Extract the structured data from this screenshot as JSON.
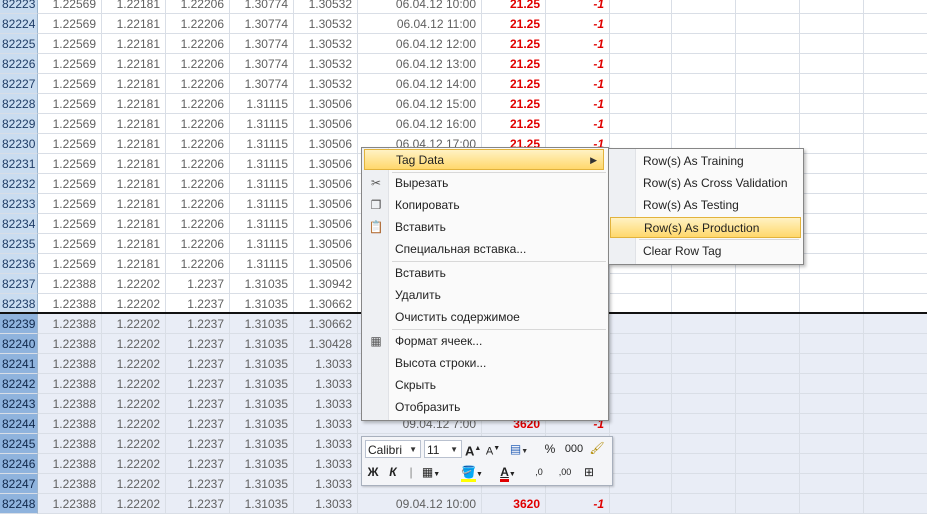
{
  "spreadsheet": {
    "rows": [
      {
        "num": "82223",
        "cells": [
          "1.22569",
          "1.22181",
          "1.22206",
          "1.30774",
          "1.30532",
          "06.04.12 10:00",
          "21.25",
          "-1"
        ],
        "sel": false
      },
      {
        "num": "82224",
        "cells": [
          "1.22569",
          "1.22181",
          "1.22206",
          "1.30774",
          "1.30532",
          "06.04.12 11:00",
          "21.25",
          "-1"
        ],
        "sel": false
      },
      {
        "num": "82225",
        "cells": [
          "1.22569",
          "1.22181",
          "1.22206",
          "1.30774",
          "1.30532",
          "06.04.12 12:00",
          "21.25",
          "-1"
        ],
        "sel": false
      },
      {
        "num": "82226",
        "cells": [
          "1.22569",
          "1.22181",
          "1.22206",
          "1.30774",
          "1.30532",
          "06.04.12 13:00",
          "21.25",
          "-1"
        ],
        "sel": false
      },
      {
        "num": "82227",
        "cells": [
          "1.22569",
          "1.22181",
          "1.22206",
          "1.30774",
          "1.30532",
          "06.04.12 14:00",
          "21.25",
          "-1"
        ],
        "sel": false
      },
      {
        "num": "82228",
        "cells": [
          "1.22569",
          "1.22181",
          "1.22206",
          "1.31115",
          "1.30506",
          "06.04.12 15:00",
          "21.25",
          "-1"
        ],
        "sel": false
      },
      {
        "num": "82229",
        "cells": [
          "1.22569",
          "1.22181",
          "1.22206",
          "1.31115",
          "1.30506",
          "06.04.12 16:00",
          "21.25",
          "-1"
        ],
        "sel": false
      },
      {
        "num": "82230",
        "cells": [
          "1.22569",
          "1.22181",
          "1.22206",
          "1.31115",
          "1.30506",
          "06.04.12 17:00",
          "21.25",
          "-1"
        ],
        "sel": false
      },
      {
        "num": "82231",
        "cells": [
          "1.22569",
          "1.22181",
          "1.22206",
          "1.31115",
          "1.30506",
          "",
          "",
          ""
        ],
        "sel": false
      },
      {
        "num": "82232",
        "cells": [
          "1.22569",
          "1.22181",
          "1.22206",
          "1.31115",
          "1.30506",
          "",
          "",
          ""
        ],
        "sel": false
      },
      {
        "num": "82233",
        "cells": [
          "1.22569",
          "1.22181",
          "1.22206",
          "1.31115",
          "1.30506",
          "",
          "",
          ""
        ],
        "sel": false
      },
      {
        "num": "82234",
        "cells": [
          "1.22569",
          "1.22181",
          "1.22206",
          "1.31115",
          "1.30506",
          "",
          "",
          ""
        ],
        "sel": false
      },
      {
        "num": "82235",
        "cells": [
          "1.22569",
          "1.22181",
          "1.22206",
          "1.31115",
          "1.30506",
          "",
          "",
          ""
        ],
        "sel": false
      },
      {
        "num": "82236",
        "cells": [
          "1.22569",
          "1.22181",
          "1.22206",
          "1.31115",
          "1.30506",
          "",
          "",
          ""
        ],
        "sel": false
      },
      {
        "num": "82237",
        "cells": [
          "1.22388",
          "1.22202",
          "1.2237",
          "1.31035",
          "1.30942",
          "",
          "",
          ""
        ],
        "sel": false
      },
      {
        "num": "82238",
        "cells": [
          "1.22388",
          "1.22202",
          "1.2237",
          "1.31035",
          "1.30662",
          "",
          "",
          ""
        ],
        "sel": false
      },
      {
        "num": "82239",
        "cells": [
          "1.22388",
          "1.22202",
          "1.2237",
          "1.31035",
          "1.30662",
          "",
          "",
          ""
        ],
        "sel": true
      },
      {
        "num": "82240",
        "cells": [
          "1.22388",
          "1.22202",
          "1.2237",
          "1.31035",
          "1.30428",
          "",
          "",
          ""
        ],
        "sel": true
      },
      {
        "num": "82241",
        "cells": [
          "1.22388",
          "1.22202",
          "1.2237",
          "1.31035",
          "1.3033",
          "",
          "",
          ""
        ],
        "sel": true
      },
      {
        "num": "82242",
        "cells": [
          "1.22388",
          "1.22202",
          "1.2237",
          "1.31035",
          "1.3033",
          "",
          "",
          ""
        ],
        "sel": true
      },
      {
        "num": "82243",
        "cells": [
          "1.22388",
          "1.22202",
          "1.2237",
          "1.31035",
          "1.3033",
          "",
          "",
          ""
        ],
        "sel": true
      },
      {
        "num": "82244",
        "cells": [
          "1.22388",
          "1.22202",
          "1.2237",
          "1.31035",
          "1.3033",
          "09.04.12 7:00",
          "3620",
          "-1"
        ],
        "sel": true
      },
      {
        "num": "82245",
        "cells": [
          "1.22388",
          "1.22202",
          "1.2237",
          "1.31035",
          "1.3033",
          "",
          "",
          ""
        ],
        "sel": true
      },
      {
        "num": "82246",
        "cells": [
          "1.22388",
          "1.22202",
          "1.2237",
          "1.31035",
          "1.3033",
          "",
          "",
          ""
        ],
        "sel": true
      },
      {
        "num": "82247",
        "cells": [
          "1.22388",
          "1.22202",
          "1.2237",
          "1.31035",
          "1.3033",
          "",
          "",
          ""
        ],
        "sel": true
      },
      {
        "num": "82248",
        "cells": [
          "1.22388",
          "1.22202",
          "1.2237",
          "1.31035",
          "1.3033",
          "09.04.12 10:00",
          "3620",
          "-1"
        ],
        "sel": true
      }
    ]
  },
  "context_menu": {
    "tag_data": "Tag Data",
    "items": [
      {
        "label": "Вырезать",
        "icon": "scissors-icon",
        "glyph": "✂"
      },
      {
        "label": "Копировать",
        "icon": "copy-icon",
        "glyph": "❐"
      },
      {
        "label": "Вставить",
        "icon": "paste-icon",
        "glyph": "📋"
      },
      {
        "label": "Специальная вставка...",
        "icon": "",
        "glyph": ""
      },
      {
        "label": "Вставить",
        "icon": "",
        "glyph": ""
      },
      {
        "label": "Удалить",
        "icon": "",
        "glyph": ""
      },
      {
        "label": "Очистить содержимое",
        "icon": "",
        "glyph": ""
      },
      {
        "label": "Формат ячеек...",
        "icon": "format-cells-icon",
        "glyph": "▦"
      },
      {
        "label": "Высота строки...",
        "icon": "",
        "glyph": ""
      },
      {
        "label": "Скрыть",
        "icon": "",
        "glyph": ""
      },
      {
        "label": "Отобразить",
        "icon": "",
        "glyph": ""
      }
    ]
  },
  "submenu": {
    "items": [
      "Row(s) As Training",
      "Row(s) As Cross Validation",
      "Row(s) As Testing",
      "Row(s) As Production",
      "Clear Row Tag"
    ],
    "highlighted": "Row(s) As Production"
  },
  "mini_toolbar": {
    "font": "Calibri",
    "size": "11",
    "percent": "%",
    "thousands": "000",
    "bold": "Ж",
    "italic": "К",
    "font_color_letter": "А",
    "grow_font": "A",
    "shrink_font": "A",
    "inc_decimal": ",0",
    "dec_decimal": ",00"
  },
  "colors": {
    "accent_highlight": "#ffd86c",
    "row_header": "#c9dcf0",
    "selected_row": "#e9edf6",
    "negative": "#e00000"
  }
}
